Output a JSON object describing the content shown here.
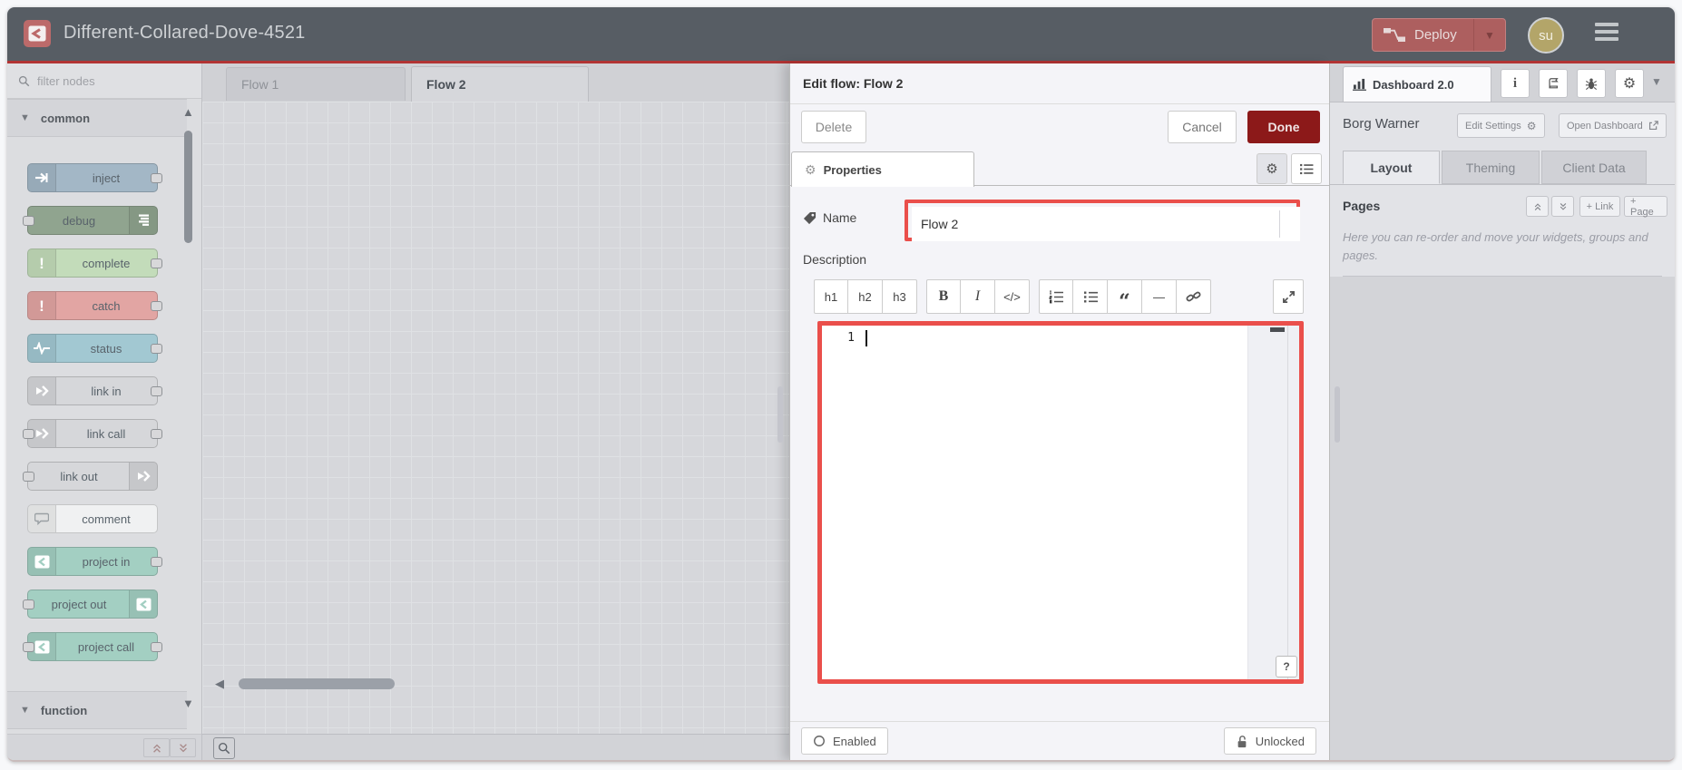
{
  "header": {
    "title": "Different-Collared-Dove-4521",
    "deploy_label": "Deploy",
    "avatar_initials": "su"
  },
  "palette": {
    "search_placeholder": "filter nodes",
    "categories": [
      {
        "id": "common",
        "label": "common"
      },
      {
        "id": "function",
        "label": "function"
      }
    ],
    "nodes": [
      {
        "label": "inject",
        "color": "#a3b7c6",
        "icon": "inject-icon",
        "iconSide": "left",
        "ports": "right"
      },
      {
        "label": "debug",
        "color": "#90a48f",
        "icon": "debug-icon",
        "iconSide": "right",
        "ports": "left"
      },
      {
        "label": "complete",
        "color": "#c3dcba",
        "icon": "exclamation-icon",
        "iconSide": "left",
        "ports": "right"
      },
      {
        "label": "catch",
        "color": "#e2a5a3",
        "icon": "exclamation-icon",
        "iconSide": "left",
        "ports": "right"
      },
      {
        "label": "status",
        "color": "#a2c8d2",
        "icon": "status-icon",
        "iconSide": "left",
        "ports": "right"
      },
      {
        "label": "link in",
        "color": "#d6d7da",
        "icon": "link-node-icon",
        "iconSide": "left",
        "ports": "right"
      },
      {
        "label": "link call",
        "color": "#d6d7da",
        "icon": "link-node-icon",
        "iconSide": "left",
        "ports": "both"
      },
      {
        "label": "link out",
        "color": "#d6d7da",
        "icon": "link-node-icon",
        "iconSide": "right",
        "ports": "left"
      },
      {
        "label": "comment",
        "color": "#f0f1f2",
        "icon": "comment-icon",
        "iconSide": "left",
        "ports": "none"
      },
      {
        "label": "project in",
        "color": "#a3cfc2",
        "icon": "project-icon",
        "iconSide": "left",
        "ports": "right"
      },
      {
        "label": "project out",
        "color": "#a3cfc2",
        "icon": "project-icon",
        "iconSide": "right",
        "ports": "left"
      },
      {
        "label": "project call",
        "color": "#a3cfc2",
        "icon": "project-icon",
        "iconSide": "left",
        "ports": "both"
      }
    ]
  },
  "workspace": {
    "tabs": [
      {
        "label": "Flow 1",
        "active": false
      },
      {
        "label": "Flow 2",
        "active": true
      }
    ]
  },
  "tray": {
    "title": "Edit flow: Flow 2",
    "delete_label": "Delete",
    "cancel_label": "Cancel",
    "done_label": "Done",
    "properties_tab": "Properties",
    "name_label": "Name",
    "name_value": "Flow 2",
    "description_label": "Description",
    "toolbar_groups": [
      [
        {
          "id": "h1",
          "glyph": "h1"
        },
        {
          "id": "h2",
          "glyph": "h2"
        },
        {
          "id": "h3",
          "glyph": "h3"
        }
      ],
      [
        {
          "id": "bold",
          "glyph": "B"
        },
        {
          "id": "italic",
          "glyph": "I"
        },
        {
          "id": "code",
          "glyph": "</>"
        }
      ],
      [
        {
          "id": "ordered-list",
          "glyph": ""
        },
        {
          "id": "unordered-list",
          "glyph": ""
        },
        {
          "id": "quote",
          "glyph": "“"
        },
        {
          "id": "horizontal-rule",
          "glyph": "—"
        },
        {
          "id": "link",
          "glyph": ""
        }
      ]
    ],
    "editor": {
      "line_number": "1",
      "help_button": "?"
    },
    "footer": {
      "enabled_label": "Enabled",
      "unlocked_label": "Unlocked"
    }
  },
  "sidebar": {
    "active_tab": "Dashboard 2.0",
    "icon_buttons": [
      "info",
      "book",
      "bug",
      "gear"
    ],
    "project_name": "Borg Warner",
    "edit_settings_label": "Edit Settings",
    "open_dashboard_label": "Open Dashboard",
    "tabs": [
      {
        "label": "Layout",
        "active": true
      },
      {
        "label": "Theming",
        "active": false
      },
      {
        "label": "Client Data",
        "active": false
      }
    ],
    "pages": {
      "label": "Pages",
      "link_label": "+ Link",
      "page_label": "+ Page"
    },
    "help_text": "Here you can re-order and move your widgets, groups and pages."
  },
  "colors": {
    "header_bg": "#575d64",
    "header_accent_red": "#b23434",
    "highlight_red": "#ea4f4b",
    "done_button_red": "#8c1919",
    "deploy_button": "#ad5f5f",
    "avatar_bg": "#b3a569"
  }
}
